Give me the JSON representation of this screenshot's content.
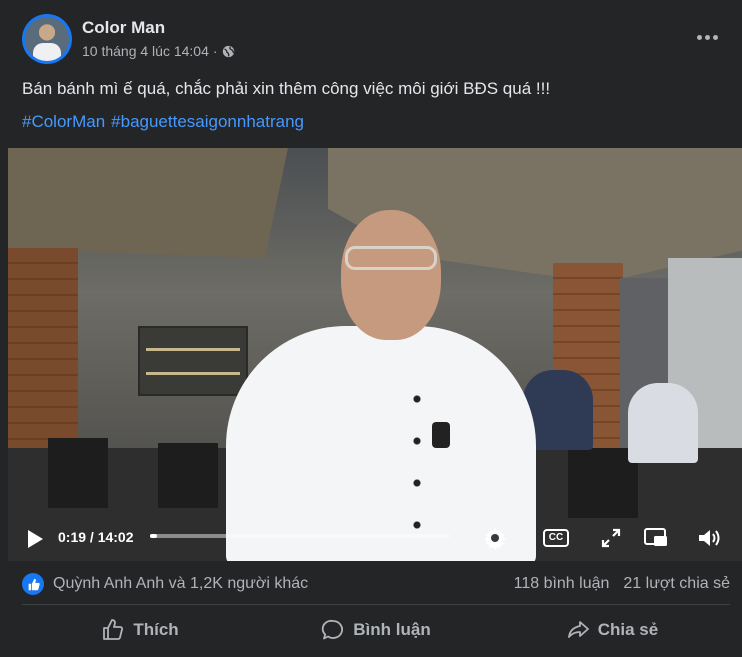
{
  "post": {
    "author": "Color Man",
    "timestamp": "10 tháng 4 lúc 14:04",
    "separator": "·",
    "audience_icon": "globe-icon",
    "caption": "Bán bánh mì ế quá, chắc phải xin thêm công việc môi giới BĐS quá !!!",
    "hashtags": [
      "#ColorMan",
      "#baguettesaigonnhatrang"
    ]
  },
  "video": {
    "current_time": "0:19 / 14:02",
    "progress_fraction": 0.023,
    "cc_label": "CC",
    "icons": [
      "play-icon",
      "settings-icon",
      "captions-icon",
      "fullscreen-icon",
      "pip-icon",
      "volume-icon"
    ]
  },
  "stats": {
    "reaction_icon": "like-icon",
    "reactors": "Quỳnh Anh Anh và 1,2K người khác",
    "comments": "118 bình luận",
    "shares": "21 lượt chia sẻ"
  },
  "actions": {
    "like": "Thích",
    "comment": "Bình luận",
    "share": "Chia sẻ"
  },
  "colors": {
    "background": "#242526",
    "text_primary": "#e4e6eb",
    "text_secondary": "#b0b3b8",
    "link": "#4599ff",
    "accent": "#1877f2"
  }
}
